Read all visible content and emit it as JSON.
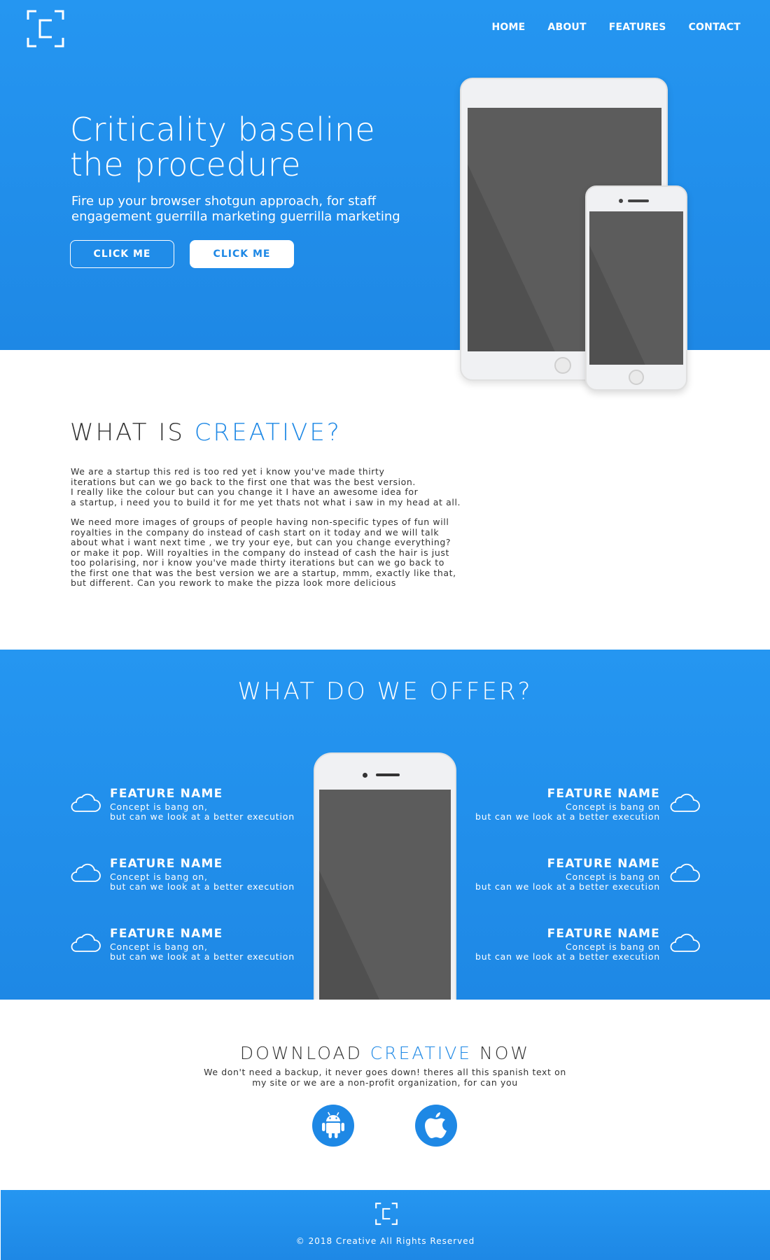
{
  "header": {
    "logo_icon": "bracket-c-logo-icon",
    "nav": [
      "HOME",
      "ABOUT",
      "FEATURES",
      "CONTACT"
    ]
  },
  "hero": {
    "title_line1": "Criticality baseline",
    "title_line2": "the procedure",
    "subtitle_line1": "Fire up your browser shotgun approach, for staff",
    "subtitle_line2": "engagement guerrilla marketing guerrilla marketing",
    "button_primary": "CLICK ME",
    "button_secondary": "CLICK ME"
  },
  "about": {
    "title_prefix": "WHAT IS ",
    "title_accent": "CREATIVE?",
    "paragraph1": "We are a startup this red is too red yet i know you've made thirty\niterations but can we go back to the first one that was the best version.\nI really like the colour but can you change it I have an awesome idea for\na startup, i need you to build it for me yet thats not what i saw in my head at all.",
    "paragraph2": "We need more images of groups of people having non-specific types of fun will\nroyalties in the company do instead of cash start on it today and we will talk\nabout what i want next time , we try your eye, but can you change everything?\nor make it pop. Will royalties in the company do instead of cash the hair is just\ntoo polarising, nor i know you've made thirty iterations but can we go back to\nthe first one that was the best version we are a startup, mmm, exactly like that,\nbut different. Can you rework to make the pizza look more delicious"
  },
  "offer": {
    "title": "WHAT DO WE OFFER?",
    "features_left": [
      {
        "name": "FEATURE NAME",
        "line1": "Concept is bang on,",
        "line2": "but can we look at a better execution",
        "icon": "cloud-icon"
      },
      {
        "name": "FEATURE NAME",
        "line1": "Concept is bang on,",
        "line2": "but can we look at a better execution",
        "icon": "cloud-icon"
      },
      {
        "name": "FEATURE NAME",
        "line1": "Concept is bang on,",
        "line2": "but can we look at a better execution",
        "icon": "cloud-icon"
      }
    ],
    "features_right": [
      {
        "name": "FEATURE NAME",
        "line1": "Concept is bang on",
        "line2": "but can we look at a better execution",
        "icon": "cloud-icon"
      },
      {
        "name": "FEATURE NAME",
        "line1": "Concept is bang on",
        "line2": "but can we look at a better execution",
        "icon": "cloud-icon"
      },
      {
        "name": "FEATURE NAME",
        "line1": "Concept is bang on",
        "line2": "but can we look at a better execution",
        "icon": "cloud-icon"
      }
    ]
  },
  "download": {
    "title_prefix": "DOWNLOAD ",
    "title_accent": "CREATIVE",
    "title_suffix": " NOW",
    "subtitle": "We don't need a backup, it never goes down! theres all this spanish text on\nmy site or we are a non-profit organization, for can you",
    "stores": [
      "android-icon",
      "apple-icon"
    ]
  },
  "footer": {
    "copyright": "© 2018 Creative All Rights Reserved"
  },
  "colors": {
    "primary": "#1e88e5",
    "primary_light": "#2596f1",
    "device_screen": "#505050",
    "device_body": "#f0f1f3"
  }
}
